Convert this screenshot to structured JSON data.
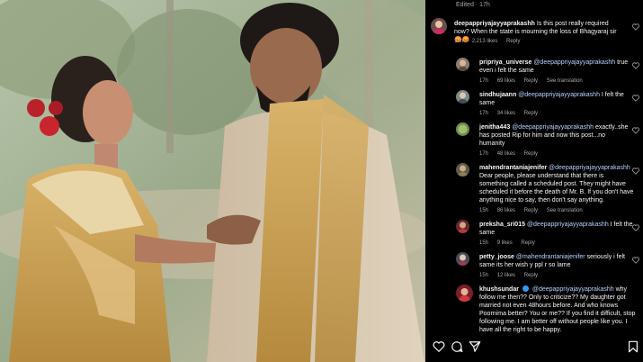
{
  "header": {
    "edited_label": "Edited · 17h"
  },
  "post": {
    "author": "deepappriyajayyaprakashh",
    "text": "Is this post really required now? When the state is mourning the loss of Bhagyaraj sir 😡😡",
    "time": "17h",
    "likes": "2,213 likes",
    "reply": "Reply"
  },
  "replies": [
    {
      "user": "pripriya_universe",
      "mention": "@deepappriyajayyaprakashh",
      "text": "true even i felt the same",
      "time": "17h",
      "likes": "69 likes",
      "reply": "Reply",
      "see": "See translation"
    },
    {
      "user": "sindhujaann",
      "mention": "@deepappriyajayyaprakashh",
      "text": "I felt the same",
      "time": "17h",
      "likes": "34 likes",
      "reply": "Reply"
    },
    {
      "user": "jenitha443",
      "mention": "@deepappriyajayyaprakashh",
      "text": "exactly..she has posted Rip for him and now this post...no humanity",
      "time": "17h",
      "likes": "48 likes",
      "reply": "Reply"
    },
    {
      "user": "mahendrantaniajenifer",
      "mention": "@deepappriyajayyaprakashh",
      "text": "Dear people, please understand that there is something called a scheduled post. They might have scheduled it before the death of Mr. B. If you don't have anything nice to say, then don't say anything.",
      "time": "15h",
      "likes": "86 likes",
      "reply": "Reply",
      "see": "See translation"
    },
    {
      "user": "preksha_sri015",
      "mention": "@deepappriyajayyaprakashh",
      "text": "I felt the same",
      "time": "15h",
      "likes": "9 likes",
      "reply": "Reply"
    },
    {
      "user": "petty_joose",
      "mention": "@mahendrantaniajenifer",
      "text": "seriously i felt same its her wish y ppl r so lame",
      "time": "15h",
      "likes": "12 likes",
      "reply": "Reply"
    },
    {
      "user": "khushsundar",
      "mention": "@deepappriyajayyaprakashh",
      "text": "why follow me then?? Only to criticize?? My daughter got married not even 48hours before. And who knows Poornima better? You or me?? If you find it difficult, stop following me. I am better off without people like you. I have all the right to be happy."
    }
  ]
}
